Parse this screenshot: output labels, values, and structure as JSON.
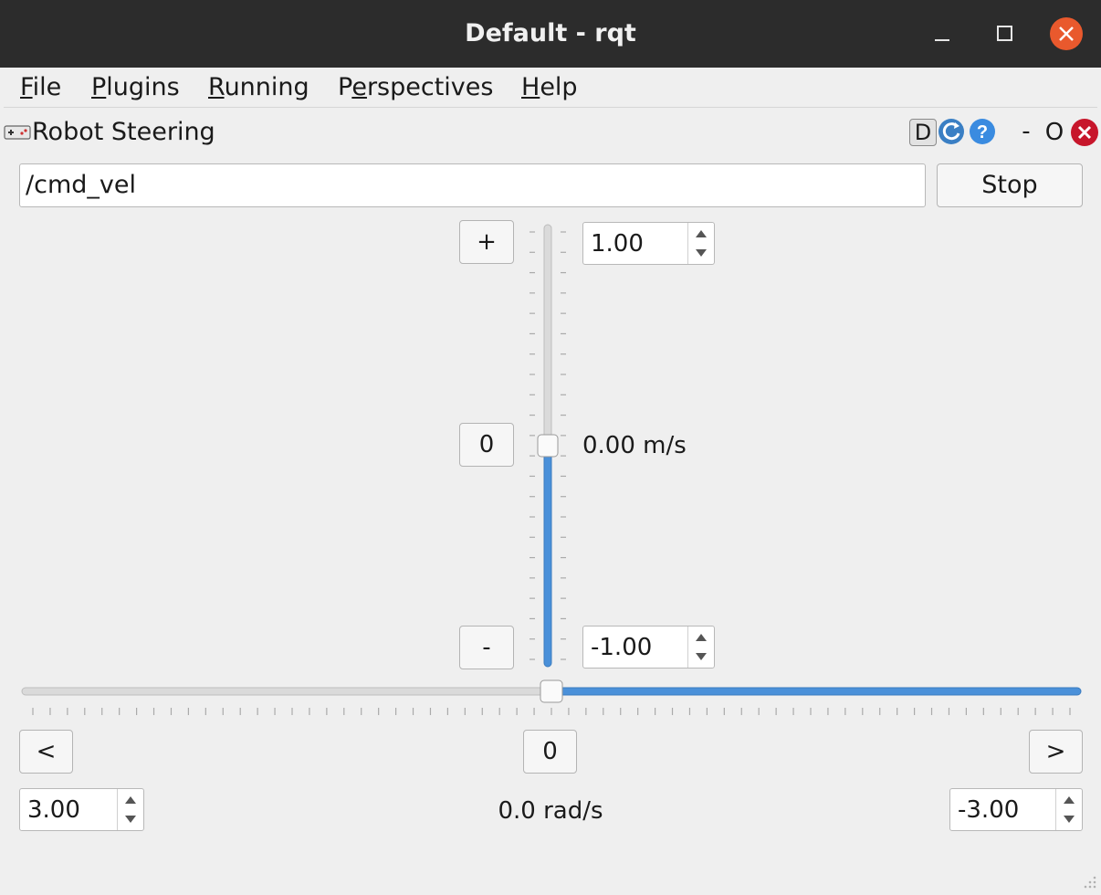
{
  "window": {
    "title": "Default - rqt"
  },
  "menu": [
    {
      "first": "F",
      "rest": "ile"
    },
    {
      "first": "P",
      "rest": "lugins"
    },
    {
      "first": "R",
      "rest": "unning"
    },
    {
      "pre": "P",
      "first": "e",
      "rest": "rspectives"
    },
    {
      "first": "H",
      "rest": "elp"
    }
  ],
  "plugin": {
    "title": "Robot Steering",
    "d_button": "D",
    "minimize": "-",
    "float": "O"
  },
  "topic": {
    "value": "/cmd_vel"
  },
  "stop_label": "Stop",
  "linear": {
    "plus": "+",
    "zero": "0",
    "minus": "-",
    "max": "1.00",
    "min": "-1.00",
    "value_text": "0.00 m/s",
    "value": 0.0
  },
  "angular": {
    "left": "<",
    "zero": "0",
    "right": ">",
    "max": "3.00",
    "min": "-3.00",
    "value_text": "0.0 rad/s",
    "value": 0.0
  },
  "colors": {
    "accent": "#4a90d9",
    "close": "#e9592d",
    "plugin_close": "#c7162b"
  }
}
